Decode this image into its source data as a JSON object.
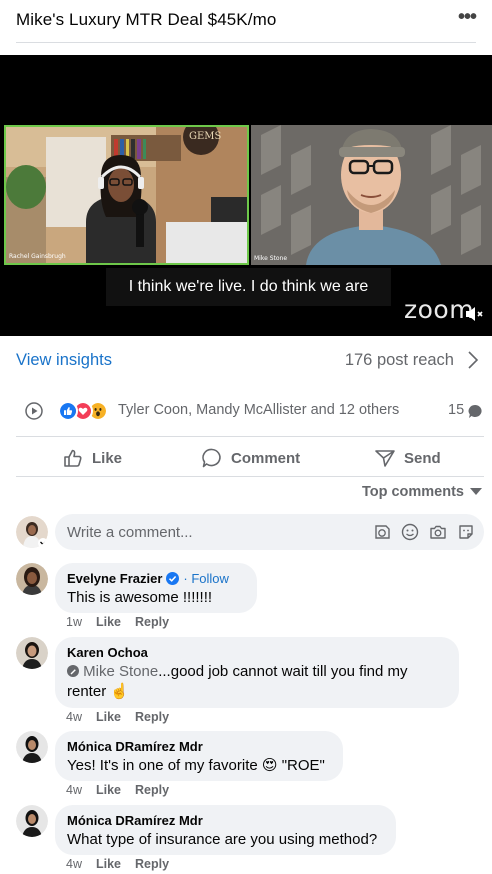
{
  "header": {
    "title": "Mike's Luxury MTR Deal $45K/mo",
    "more_label": "•••"
  },
  "video": {
    "left_participant": "Rachel Gainsbrugh",
    "right_participant": "Mike Stone",
    "caption": "I think we're live. I do think we are",
    "logo_text": "zoom",
    "sign_text": "GEMS"
  },
  "insights": {
    "link": "View insights",
    "reach": "176 post reach"
  },
  "reactions": {
    "names": "Tyler Coon, Mandy McAllister and 12 others",
    "comment_count": "15",
    "emoji": [
      "like",
      "love",
      "wow"
    ]
  },
  "actions": {
    "like": "Like",
    "comment": "Comment",
    "send": "Send"
  },
  "sort": {
    "label": "Top comments"
  },
  "composer": {
    "placeholder": "Write a comment..."
  },
  "comments": [
    {
      "name": "Evelyne Frazier",
      "verified": true,
      "follow": "· Follow",
      "text": "This is awesome !!!!!!!",
      "time": "1w",
      "like": "Like",
      "reply": "Reply"
    },
    {
      "name": "Karen Ochoa",
      "mention": "Mike Stone",
      "text": "...good job cannot wait till you find my renter ☝️",
      "time": "4w",
      "like": "Like",
      "reply": "Reply"
    },
    {
      "name": "Mónica DRamírez Mdr",
      "text": "Yes! It's in one of my favorite 😍 \"ROE\"",
      "time": "4w",
      "like": "Like",
      "reply": "Reply"
    },
    {
      "name": "Mónica DRamírez Mdr",
      "text": "What type of insurance are you using method?",
      "time": "4w",
      "like": "Like",
      "reply": "Reply"
    }
  ],
  "colors": {
    "link": "#1a73c9",
    "secondary_text": "#65676b",
    "bubble": "#f0f2f5",
    "active_speaker": "#6ec84a"
  }
}
